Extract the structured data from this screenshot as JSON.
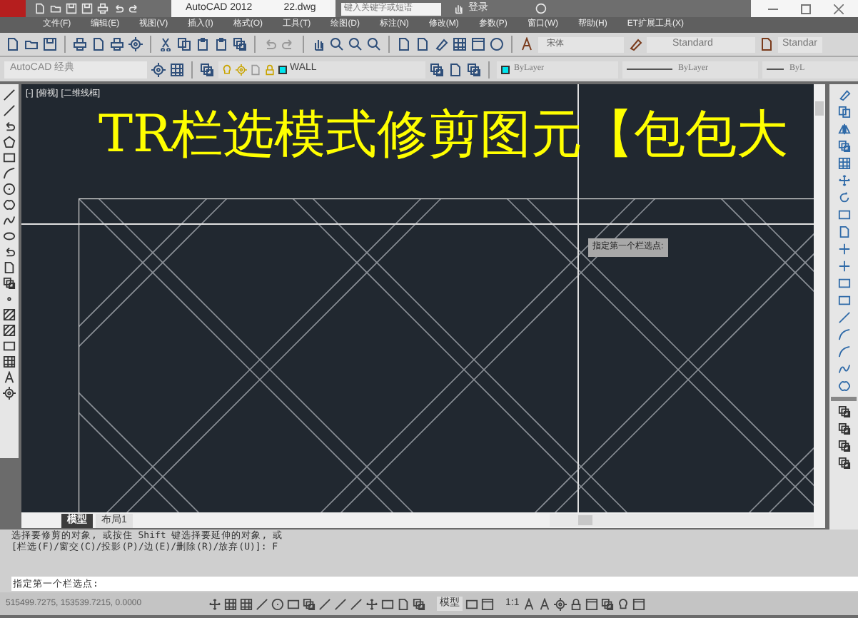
{
  "title_bar": {
    "app_name": "AutoCAD 2012",
    "file_name": "22.dwg",
    "search": {
      "placeholder": "键入关键字或短语"
    },
    "login": "登录"
  },
  "menu_bar": {
    "items": [
      "文件(F)",
      "编辑(E)",
      "视图(V)",
      "插入(I)",
      "格式(O)",
      "工具(T)",
      "绘图(D)",
      "标注(N)",
      "修改(M)",
      "参数(P)",
      "窗口(W)",
      "帮助(H)",
      "ET扩展工具(X)"
    ]
  },
  "styles_toolbar": {
    "font": "宋体",
    "text_style": "Standard",
    "dim_style": "Standar"
  },
  "properties_toolbar": {
    "workspace": "AutoCAD 经典",
    "layer": "WALL",
    "color_setting": "ByLayer",
    "linetype": "ByLayer",
    "lineweight": "ByL"
  },
  "viewport": {
    "labels": [
      "[-]",
      "[俯视]",
      "[二维线框]"
    ],
    "title": "TR栏选模式修剪图元【包包大",
    "tooltip": "指定第一个栏选点:"
  },
  "layout_tabs": [
    {
      "label": "模型",
      "selected": true
    },
    {
      "label": "布局1",
      "selected": false
    }
  ],
  "command_history": [
    "选择要修剪的对象, 或按住 Shift 键选择要延伸的对象, 或",
    "[栏选(F)/窗交(C)/投影(P)/边(E)/删除(R)/放弃(U)]:  F"
  ],
  "command_prompt": "指定第一个栏选点:",
  "status_bar": {
    "coordinates": "515499.7275, 153539.7215, 0.0000",
    "space": "模型",
    "scale": "1:1"
  }
}
